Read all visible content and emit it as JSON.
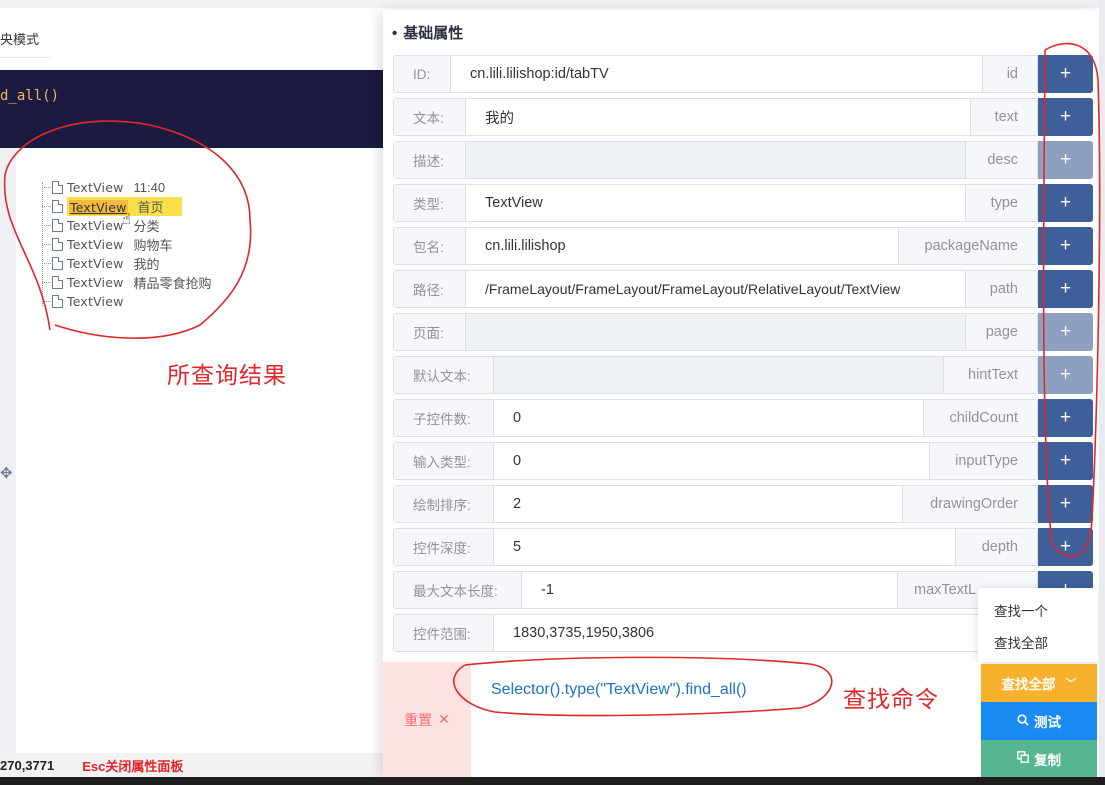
{
  "left": {
    "mode_label": "央模式",
    "code_snippet": "d_all()",
    "tree_items": [
      {
        "name": "TextView",
        "desc": "11:40"
      },
      {
        "name": "TextView",
        "desc": "首页"
      },
      {
        "name": "TextView",
        "desc": "分类"
      },
      {
        "name": "TextView",
        "desc": "购物车"
      },
      {
        "name": "TextView",
        "desc": "我的"
      },
      {
        "name": "TextView",
        "desc": "精品零食抢购"
      },
      {
        "name": "TextView",
        "desc": ""
      }
    ],
    "status_coord": "270,3771",
    "status_esc": "Esc关闭属性面板"
  },
  "annotations": {
    "results_label": "所查询结果",
    "command_label": "查找命令"
  },
  "panel": {
    "title": "基础属性",
    "rows": [
      {
        "label": "ID:",
        "value": "cn.lili.lilishop:id/tabTV",
        "key": "id",
        "enabled": true
      },
      {
        "label": "文本:",
        "value": "我的",
        "key": "text",
        "enabled": true
      },
      {
        "label": "描述:",
        "value": "",
        "key": "desc",
        "enabled": false
      },
      {
        "label": "类型:",
        "value": "TextView",
        "key": "type",
        "enabled": true
      },
      {
        "label": "包名:",
        "value": "cn.lili.lilishop",
        "key": "packageName",
        "enabled": true
      },
      {
        "label": "路径:",
        "value": "/FrameLayout/FrameLayout/FrameLayout/RelativeLayout/TextView",
        "key": "path",
        "enabled": true
      },
      {
        "label": "页面:",
        "value": "",
        "key": "page",
        "enabled": false
      },
      {
        "label": "默认文本:",
        "value": "",
        "key": "hintText",
        "enabled": false
      },
      {
        "label": "子控件数:",
        "value": "0",
        "key": "childCount",
        "enabled": true
      },
      {
        "label": "输入类型:",
        "value": "0",
        "key": "inputType",
        "enabled": true
      },
      {
        "label": "绘制排序:",
        "value": "2",
        "key": "drawingOrder",
        "enabled": true
      },
      {
        "label": "控件深度:",
        "value": "5",
        "key": "depth",
        "enabled": true
      },
      {
        "label": "最大文本长度:",
        "value": "-1",
        "key": "maxTextL",
        "enabled": true
      },
      {
        "label": "控件范围:",
        "value": "1830,3735,1950,3806",
        "key": "",
        "enabled": true
      }
    ],
    "plus_label": "+",
    "dropdown": [
      "查找一个",
      "查找全部"
    ],
    "reset_label": "重置",
    "command": "Selector().type(\"TextView\").find_all()",
    "find_all_label": "查找全部",
    "test_label": "测试",
    "copy_label": "复制"
  },
  "colors": {
    "plus_enabled": "#3e5f9a",
    "plus_disabled": "#8da0c2",
    "find_all": "#f8b12c",
    "test": "#1a8af5",
    "copy": "#55b78f",
    "annotation_red": "#e1272a"
  }
}
